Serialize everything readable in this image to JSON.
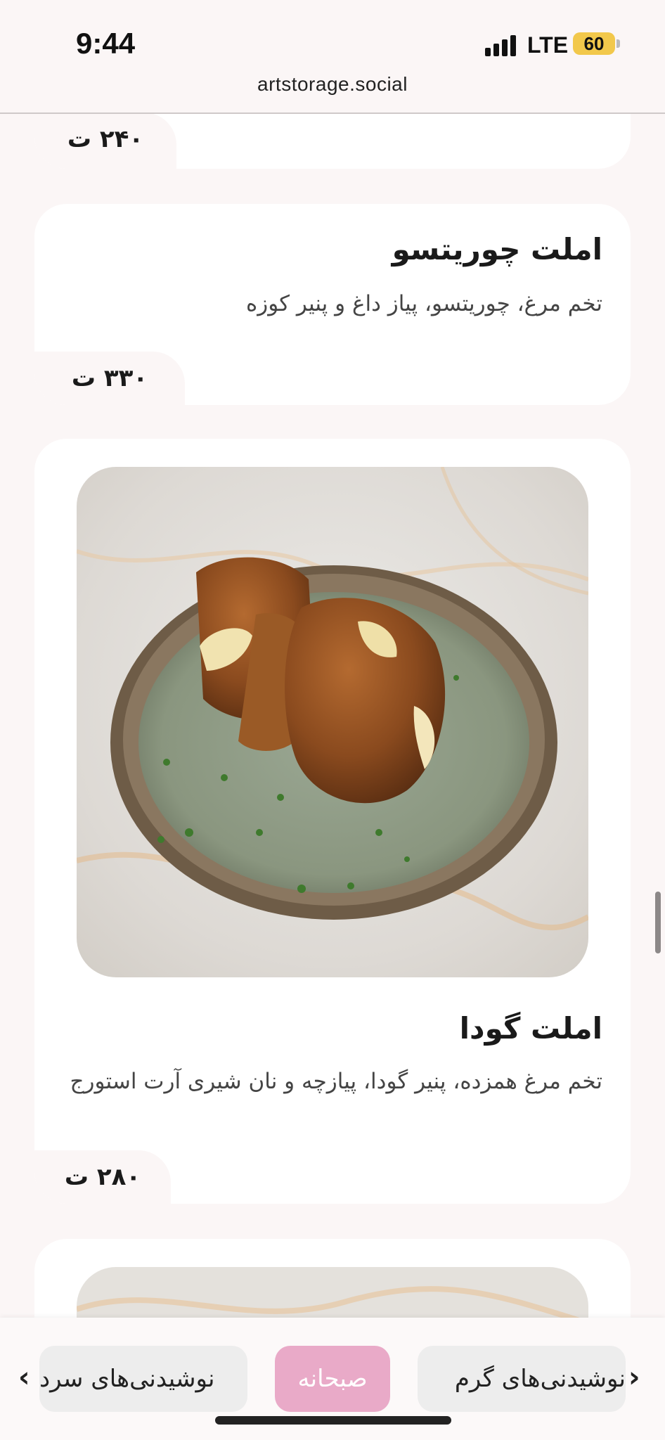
{
  "status_bar": {
    "time": "9:44",
    "network": "LTE",
    "battery": "60"
  },
  "browser": {
    "url": "artstorage.social"
  },
  "menu_items": [
    {
      "price": "۲۴۰ ت"
    },
    {
      "title": "املت چوریتسو",
      "description": "تخم مرغ، چوریتسو، پیاز داغ و پنیر کوزه",
      "price": "۳۳۰ ت"
    },
    {
      "title": "املت گودا",
      "description": "تخم مرغ همزده، پنیر گودا، پیازچه و نان شیری آرت استورج",
      "price": "۲۸۰ ت"
    }
  ],
  "category_nav": {
    "prev_arrow": "‹",
    "next_arrow": "›",
    "tabs": [
      {
        "label": "نوشیدنی‌های سرد",
        "active": false
      },
      {
        "label": "صبحانه",
        "active": true
      },
      {
        "label": "نوشیدنی‌های گرم",
        "active": false
      }
    ]
  },
  "colors": {
    "background": "#fbf6f6",
    "card": "#ffffff",
    "active_tab": "#e9aac8",
    "inactive_tab": "#ededed",
    "battery": "#f2c84b"
  }
}
